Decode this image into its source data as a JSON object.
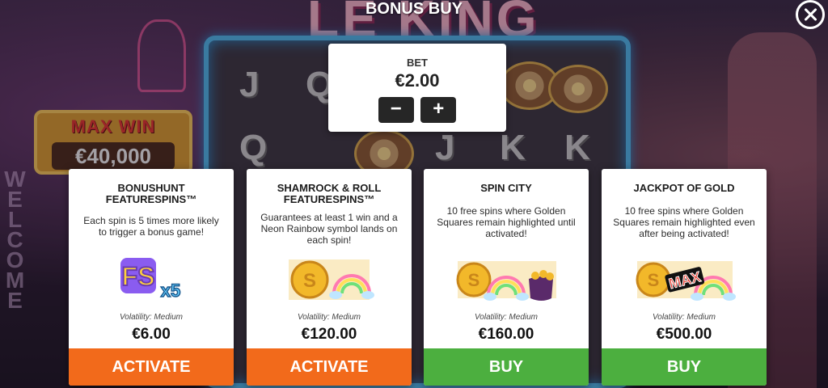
{
  "header": {
    "title": "BONUS BUY"
  },
  "background": {
    "logo": "LE KING",
    "max_win_label": "MAX WIN",
    "max_win_value": "€40,000",
    "welcome": "WELCOME"
  },
  "bet": {
    "label": "BET",
    "value": "€2.00",
    "decrease": "−",
    "increase": "+"
  },
  "cards": [
    {
      "title": "BONUSHUNT\nFEATURESPINS™",
      "description": "Each spin is 5 times more likely to trigger a bonus game!",
      "volatility": "Volatility: Medium",
      "price": "€6.00",
      "action": "ACTIVATE",
      "icon": "fs-x5-icon",
      "art_text": "FS",
      "art_multiplier": "x5"
    },
    {
      "title": "SHAMROCK & ROLL\nFEATURESPINS™",
      "description": "Guarantees at least 1 win and a Neon Rainbow symbol lands on each spin!",
      "volatility": "Volatility: Medium",
      "price": "€120.00",
      "action": "ACTIVATE",
      "icon": "coin-rainbow-icon"
    },
    {
      "title": "SPIN CITY",
      "description": "10 free spins where Golden Squares remain highlighted until activated!",
      "volatility": "Volatility: Medium",
      "price": "€160.00",
      "action": "BUY",
      "icon": "coin-rainbow-pot-icon"
    },
    {
      "title": "JACKPOT OF GOLD",
      "description": "10 free spins where Golden Squares remain highlighted even after being activated!",
      "volatility": "Volatility: Medium",
      "price": "€500.00",
      "action": "BUY",
      "icon": "coin-max-rainbow-icon",
      "art_text": "MAX"
    }
  ],
  "colors": {
    "activate": "#f26a1b",
    "buy": "#4caf3f",
    "reel_frame": "#4fb6e8"
  }
}
